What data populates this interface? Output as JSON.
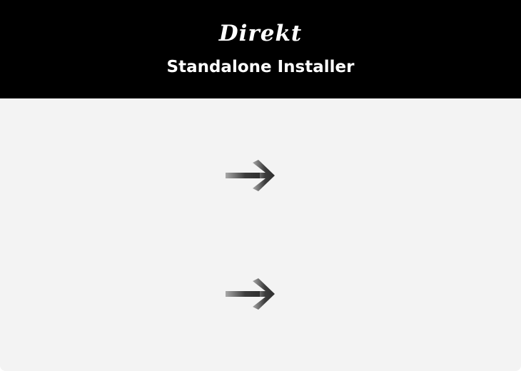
{
  "header": {
    "logo_text": "Direkt",
    "subtitle": "Standalone Installer"
  },
  "colors": {
    "header_bg": "#000000",
    "content_bg": "#f3f3f3",
    "arrow_dark": "#3a3a3a",
    "arrow_light": "#9a9a9a"
  },
  "actions": [
    {
      "icon": "arrow-right-icon"
    },
    {
      "icon": "arrow-right-icon"
    }
  ]
}
